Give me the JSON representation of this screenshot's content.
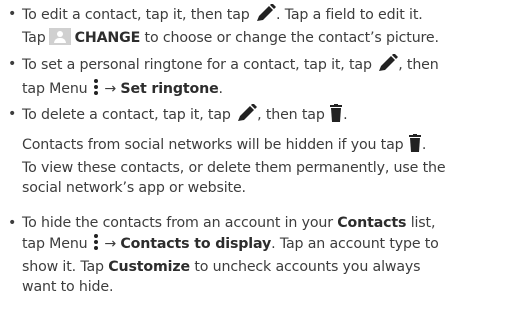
{
  "bullet": "•",
  "edit": {
    "t1": "To edit a contact, tap it, then tap",
    "t2": ". Tap a field to edit it.",
    "t3": "Tap",
    "change_label": "CHANGE",
    "t4": "to choose or change the contact’s picture."
  },
  "ringtone": {
    "t1": "To set a personal ringtone for a contact, tap it, tap",
    "t2": ", then",
    "t3": "tap Menu",
    "arrow": "→",
    "set_ringtone": "Set ringtone",
    "t4": "."
  },
  "delete": {
    "t1": "To delete a contact, tap it, tap",
    "t2": ", then tap",
    "t3": "."
  },
  "social": {
    "t1": "Contacts from social networks will be hidden if you tap",
    "t2": ".",
    "t3": "To view these contacts, or delete them permanently, use the",
    "t4": "social network’s app or website."
  },
  "hide": {
    "t1": "To hide the contacts from an account in your",
    "contacts": "Contacts",
    "t2": "list,",
    "t3": "tap Menu",
    "arrow": "→",
    "contacts_to_display": "Contacts to display",
    "t4": ". Tap an account type to",
    "t5": "show it. Tap",
    "customize": "Customize",
    "t6": "to uncheck accounts you always",
    "t7": "want to hide."
  },
  "icons": [
    "pencil-icon",
    "contact-photo-icon",
    "menu-icon",
    "trash-icon"
  ]
}
